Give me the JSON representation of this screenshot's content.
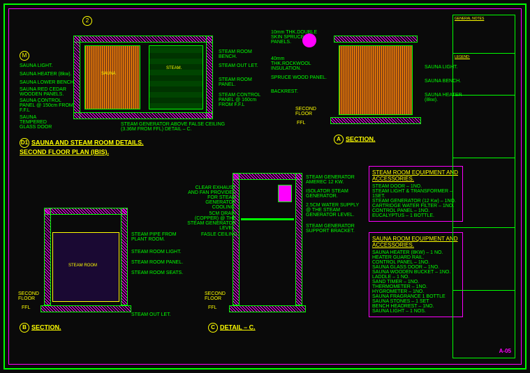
{
  "header": {
    "general_notes": "GENERAL NOTES"
  },
  "plan": {
    "marker": "D1",
    "grid_v": "2",
    "grid_h": "M",
    "title1": "SAUNA AND STEAM ROOM DETAILS.",
    "title2": "SECOND FLOOR  PLAN  (IBIS).",
    "steam_note": "STEAM GENERATOR ABOVE FALSE CEILING (3.36M FROM FFL) DETAIL – C.",
    "rooms": {
      "sauna": "SAUNA",
      "steam": "STEAM."
    },
    "labels_left": [
      "SAUNA LIGHT.",
      "SAUNA HEATER (8kw).",
      "SAUNA LOWER BENCH.",
      "SAUNA RED CEDAR WOODEN PANELS.",
      "SAUNA CONTROL PANEL @ 150cm FROM F.F.L",
      "SAUNA TEMPERED GLASS DOOR"
    ],
    "labels_right": [
      "STEAM ROOM BENCH.",
      "STEAM OUT LET.",
      "STEAM ROOM PANEL.",
      "STEAM CONTROL PANEL @ 160cm FROM F.F.L"
    ]
  },
  "sectionA": {
    "marker": "A",
    "title": "SECTION.",
    "floor": "SECOND FLOOR",
    "ffl": "FFL",
    "labels_left": [
      "10mm THK.DOUBLE SKIN SPRUCE PANELS.",
      "40mm THK.ROCKWOOL INSULATION.",
      "SPRUCE WOOD PANEL.",
      "BACKREST."
    ],
    "labels_right": [
      "SAUNA LIGHT.",
      "SAUNA BENCH.",
      "SAUNA HEATER (8kw)."
    ]
  },
  "sectionB": {
    "marker": "B",
    "title": "SECTION.",
    "floor": "SECOND FLOOR",
    "ffl": "FFL",
    "room": "STEAM ROOM",
    "labels": [
      "STEAM PIPE FROM PLANT ROOM.",
      "STEAM ROOM LIGHT.",
      "STEAM ROOM PANEL.",
      "STEAM ROOM SEATS.",
      "STEAM OUT LET."
    ]
  },
  "detailC": {
    "marker": "C",
    "title": "DETAIL – C.",
    "floor": "SECOND FLOOR",
    "ffl": "FFL",
    "labels_left": [
      "CLEAR EXHAUST AND FAN PROVIDED FOR STEAM GENERATOR COOLING.",
      "5CM DRAIN (COPPER) @ THE STEAM GENERATOR LEVEL.",
      "FASLE CEILING."
    ],
    "labels_right": [
      "STEAM GENERATOR AMEREC 12 KW.",
      "ISOLATOR STEAM GENERATOR.",
      "2.5CM WATER SUPPLY @ THE STEAM GENERATOR LEVEL.",
      "STEAM GENERATOR SUPPORT BRACKET."
    ]
  },
  "steam_equip": {
    "title": "STEAM ROOM EQUIPMENT AND ACCESSORIES.",
    "items": [
      "STEAM DOOR – 1NO.",
      "STEAM LIGHT & TRANSFORMER – 1SET.",
      "STEAM GENERATOR (12 Kw) – 1NO.",
      "CARTRIDGE WATER FILTER – 1NO.",
      "CONTROL PANEL – 1NO.",
      "EUCALYPTUS – 1 BOTTLE."
    ]
  },
  "sauna_equip": {
    "title": "SAUNA ROOM EQUIPMENT AND ACCESSORIES.",
    "items": [
      "SAUNA HEATER (8KW) – 1 NO.",
      "HEATER GUARD RAIL.",
      "CONTROL PANEL – 1NO.",
      "SAUNA GLASS DOOR – 1NO.",
      "SAUNA WOODEN BUCKET – 1NO.",
      "LADDLE – 1 NO.",
      "SAND TIMER – 1NO.",
      "THERMOMETER – 1NO.",
      "HYGROMETER – 1NO.",
      "SAUNA FRAGRANCE 1 BOTTLE",
      "SAUNA STONES – 1 SET",
      "BENCH HEADREST – 1NO.",
      "SAUNA LIGHT – 1 NOS."
    ]
  },
  "titleblock": {
    "notes": "GENERAL NOTES",
    "legend": "LEGEND:",
    "dwg_no": "A-05"
  }
}
